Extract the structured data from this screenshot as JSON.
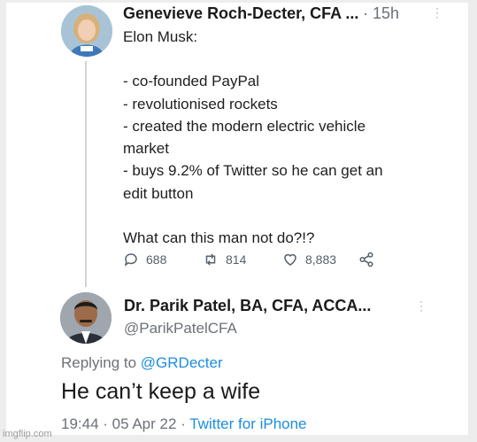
{
  "tweet": {
    "author_name": "Genevieve Roch-Decter, CFA ...",
    "time": "· 15h",
    "more_glyph": "⋮",
    "lines": [
      "Elon Musk:",
      "- co-founded PayPal",
      "- revolutionised rockets",
      "- created the modern electric vehicle",
      "market",
      "- buys 9.2% of Twitter so he can get an",
      "edit button",
      "What can this man not do?!?"
    ],
    "replies": "688",
    "retweets": "814",
    "likes": "8,883"
  },
  "reply": {
    "author_name": "Dr. Parik Patel, BA, CFA, ACCA...",
    "handle": "@ParikPatelCFA",
    "more_glyph": "⋮",
    "replying_label": "Replying to ",
    "replying_to": "@GRDecter",
    "text": "He can’t keep a wife",
    "timestamp": "19:44 · 05 Apr 22 · ",
    "client": "Twitter for iPhone"
  },
  "watermark": "imgflip.com",
  "colors": {
    "link": "#1d8ee0",
    "muted": "#6b7178"
  }
}
